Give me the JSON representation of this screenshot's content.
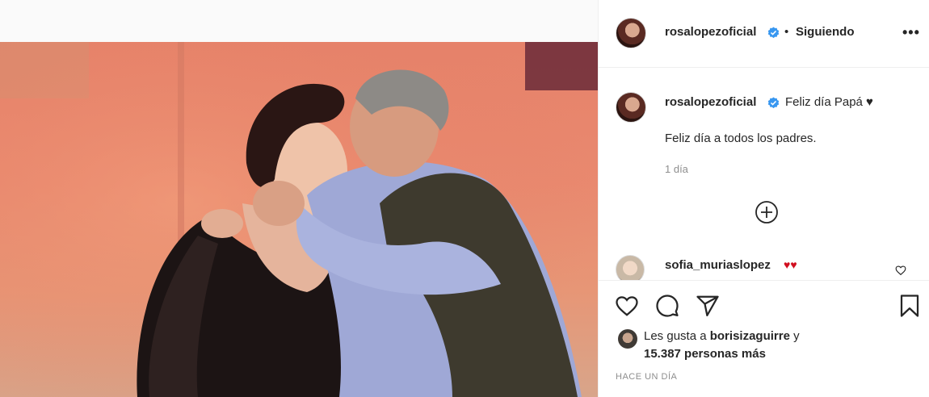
{
  "post": {
    "photo_alt": ""
  },
  "header": {
    "username": "rosalopezoficial",
    "separator": "•",
    "follow_status": "Siguiendo",
    "more": "•••"
  },
  "caption": {
    "username": "rosalopezoficial",
    "title": "Feliz día Papá ♥",
    "body": "Feliz día a todos los padres.",
    "time": "1 día"
  },
  "comments": [
    {
      "username": "sofia_muriaslopez",
      "text": "♥♥"
    }
  ],
  "likes": {
    "prefix": "Les gusta a ",
    "user": "borisizaguirre",
    "joiner": " y",
    "count_text": "15.387 personas más"
  },
  "posted": "HACE UN DÍA",
  "colors": {
    "verified": "#3897f0",
    "heart_red": "#d10f1f",
    "muted": "#8e8e8e"
  },
  "icons": [
    "verified-badge-icon",
    "more-options-icon",
    "load-more-comments-icon",
    "heart-icon",
    "comment-icon",
    "share-icon",
    "bookmark-icon",
    "comment-like-icon"
  ]
}
